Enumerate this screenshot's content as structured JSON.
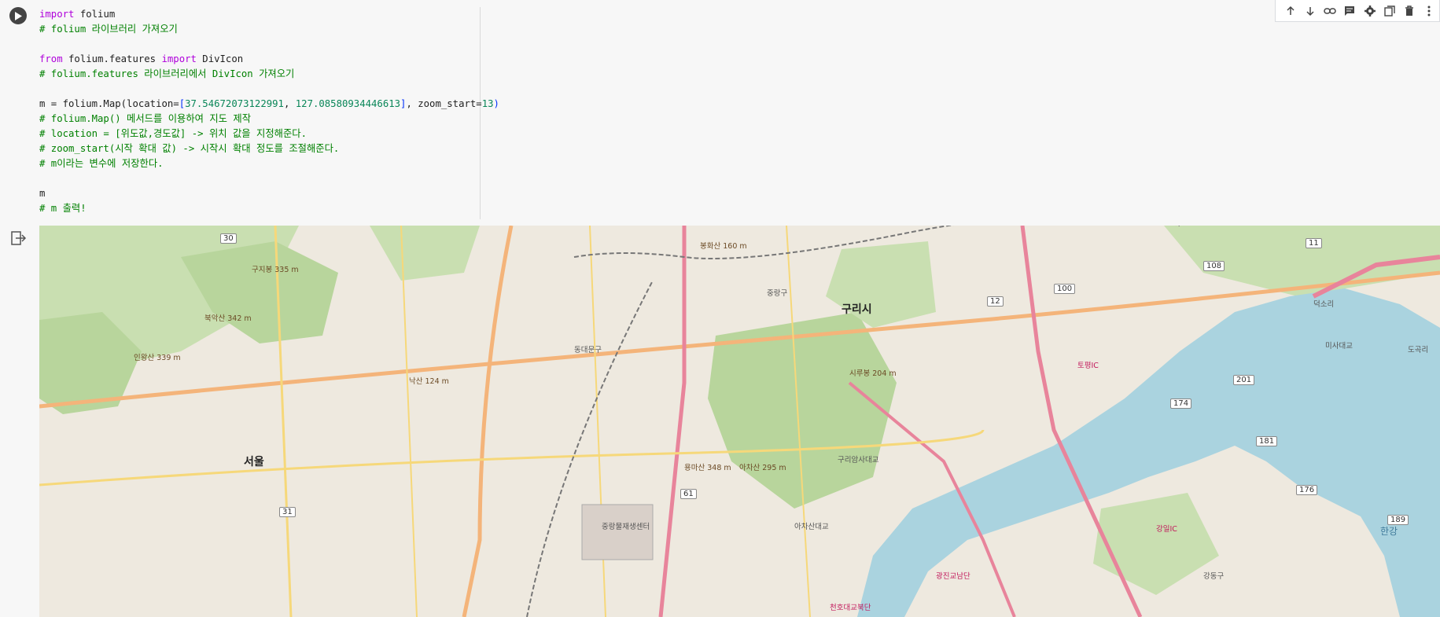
{
  "code_cell": {
    "lines": [
      [
        {
          "t": "import",
          "c": "kw"
        },
        {
          "t": " folium",
          "c": ""
        }
      ],
      [
        {
          "t": "# folium 라이브러리 가져오기",
          "c": "cm"
        }
      ],
      [],
      [
        {
          "t": "from",
          "c": "kw"
        },
        {
          "t": " folium.features ",
          "c": ""
        },
        {
          "t": "import",
          "c": "kw"
        },
        {
          "t": " DivIcon",
          "c": ""
        }
      ],
      [
        {
          "t": "# folium.features 라이브러리에서 DivIcon 가져오기",
          "c": "cm"
        }
      ],
      [],
      [
        {
          "t": "m = folium.Map(location=",
          "c": ""
        },
        {
          "t": "[",
          "c": "br"
        },
        {
          "t": "37.54672073122991",
          "c": "num"
        },
        {
          "t": ", ",
          "c": ""
        },
        {
          "t": "127.08580934446613",
          "c": "num"
        },
        {
          "t": "]",
          "c": "br"
        },
        {
          "t": ", zoom_start=",
          "c": ""
        },
        {
          "t": "13",
          "c": "num"
        },
        {
          "t": ")",
          "c": "br"
        }
      ],
      [
        {
          "t": "# folium.Map() 메서드를 이용하여 지도 제작",
          "c": "cm"
        }
      ],
      [
        {
          "t": "# location = [위도값,경도값] -> 위치 값을 지정해준다.",
          "c": "cm"
        }
      ],
      [
        {
          "t": "# zoom_start(시작 확대 값) -> 시작시 확대 정도를 조절해준다.",
          "c": "cm"
        }
      ],
      [
        {
          "t": "# m이라는 변수에 저장한다.",
          "c": "cm"
        }
      ],
      [],
      [
        {
          "t": "m",
          "c": ""
        }
      ],
      [
        {
          "t": "# m 출력!",
          "c": "cm"
        }
      ]
    ]
  },
  "toolbar": {
    "icons": [
      "arrow-up-icon",
      "arrow-down-icon",
      "link-icon",
      "comment-icon",
      "gear-icon",
      "mirror-cell-icon",
      "delete-icon",
      "more-icon"
    ]
  },
  "map": {
    "labels": [
      {
        "text": "서울",
        "cls": "ml-big"
      },
      {
        "text": "구리시",
        "cls": "ml-big"
      },
      {
        "text": "한강",
        "cls": "ml-river"
      },
      {
        "text": "중랑물재생센터",
        "cls": "ml-sm"
      },
      {
        "text": "아차산대교",
        "cls": "ml-sm"
      },
      {
        "text": "구리암사대교",
        "cls": "ml-sm"
      },
      {
        "text": "강일IC",
        "cls": "ml-pink"
      },
      {
        "text": "토평IC",
        "cls": "ml-pink"
      },
      {
        "text": "구지봉 335 m",
        "cls": "ml-peak"
      },
      {
        "text": "북악산 342 m",
        "cls": "ml-peak"
      },
      {
        "text": "인왕산 339 m",
        "cls": "ml-peak"
      },
      {
        "text": "낙산 124 m",
        "cls": "ml-peak"
      },
      {
        "text": "용마산 348 m",
        "cls": "ml-peak"
      },
      {
        "text": "아차산 295 m",
        "cls": "ml-peak"
      },
      {
        "text": "봉화산 160 m",
        "cls": "ml-peak"
      },
      {
        "text": "시루봉 204 m",
        "cls": "ml-peak"
      },
      {
        "text": "덕소리",
        "cls": "ml-sm"
      },
      {
        "text": "도곡리",
        "cls": "ml-sm"
      },
      {
        "text": "미사대교",
        "cls": "ml-sm"
      },
      {
        "text": "광진교남단",
        "cls": "ml-pink"
      },
      {
        "text": "천호대교북단",
        "cls": "ml-pink"
      },
      {
        "text": "강동구",
        "cls": "ml-sm"
      },
      {
        "text": "중랑구",
        "cls": "ml-sm"
      },
      {
        "text": "동대문구",
        "cls": "ml-sm"
      }
    ],
    "shields": [
      "30",
      "11",
      "108",
      "100",
      "12",
      "201",
      "174",
      "181",
      "176",
      "189",
      "61",
      "31"
    ]
  }
}
